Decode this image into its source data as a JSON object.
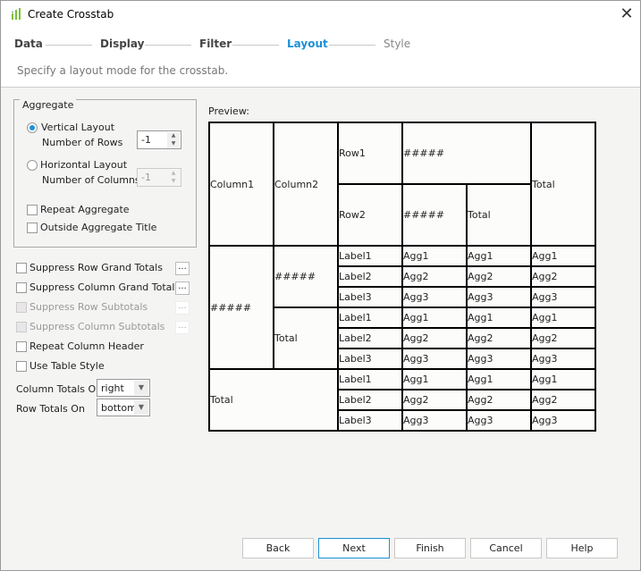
{
  "window": {
    "title": "Create Crosstab",
    "icon": "crosstab-app-icon",
    "close_icon": "close-icon"
  },
  "steps": [
    {
      "label": "Data",
      "state": "done"
    },
    {
      "label": "Display",
      "state": "done"
    },
    {
      "label": "Filter",
      "state": "done"
    },
    {
      "label": "Layout",
      "state": "active"
    },
    {
      "label": "Style",
      "state": "pending"
    }
  ],
  "description": "Specify a layout mode for the crosstab.",
  "aggregate": {
    "title": "Aggregate",
    "vertical_label": "Vertical Layout",
    "vertical_selected": true,
    "rows_label": "Number of Rows",
    "rows_value": "-1",
    "horizontal_label": "Horizontal Layout",
    "horizontal_selected": false,
    "columns_label": "Number of Columns",
    "columns_value": "-1",
    "repeat_aggregate": "Repeat Aggregate",
    "outside_title": "Outside Aggregate Title"
  },
  "options": [
    {
      "label": "Suppress Row Grand Totals",
      "checked": false,
      "enabled": true,
      "more": "..."
    },
    {
      "label": "Suppress Column Grand Totals",
      "checked": false,
      "enabled": true,
      "more": "..."
    },
    {
      "label": "Suppress Row Subtotals",
      "checked": false,
      "enabled": false,
      "more": "..."
    },
    {
      "label": "Suppress Column Subtotals",
      "checked": false,
      "enabled": false,
      "more": "..."
    },
    {
      "label": "Repeat Column Header",
      "checked": false,
      "enabled": true
    },
    {
      "label": "Use Table Style",
      "checked": false,
      "enabled": true
    }
  ],
  "column_totals": {
    "label": "Column Totals On",
    "value": "right"
  },
  "row_totals": {
    "label": "Row Totals On",
    "value": "bottom"
  },
  "preview": {
    "label": "Preview:",
    "header": {
      "column1": "Column1",
      "column2": "Column2",
      "row1": "Row1",
      "row1_value": "#####",
      "row2": "Row2",
      "row2_value": "#####",
      "row2_total": "Total",
      "total": "Total"
    },
    "group": "#####",
    "subgroup": "#####",
    "subtotal": "Total",
    "grand_total": "Total",
    "rows": [
      {
        "label": "Label1",
        "cells": [
          "Agg1",
          "Agg1",
          "Agg1"
        ]
      },
      {
        "label": "Label2",
        "cells": [
          "Agg2",
          "Agg2",
          "Agg2"
        ]
      },
      {
        "label": "Label3",
        "cells": [
          "Agg3",
          "Agg3",
          "Agg3"
        ]
      },
      {
        "label": "Label1",
        "cells": [
          "Agg1",
          "Agg1",
          "Agg1"
        ]
      },
      {
        "label": "Label2",
        "cells": [
          "Agg2",
          "Agg2",
          "Agg2"
        ]
      },
      {
        "label": "Label3",
        "cells": [
          "Agg3",
          "Agg3",
          "Agg3"
        ]
      },
      {
        "label": "Label1",
        "cells": [
          "Agg1",
          "Agg1",
          "Agg1"
        ]
      },
      {
        "label": "Label2",
        "cells": [
          "Agg2",
          "Agg2",
          "Agg2"
        ]
      },
      {
        "label": "Label3",
        "cells": [
          "Agg3",
          "Agg3",
          "Agg3"
        ]
      }
    ]
  },
  "buttons": {
    "back": "Back",
    "next": "Next",
    "finish": "Finish",
    "cancel": "Cancel",
    "help": "Help"
  },
  "colors": {
    "accent": "#1e90d6"
  }
}
